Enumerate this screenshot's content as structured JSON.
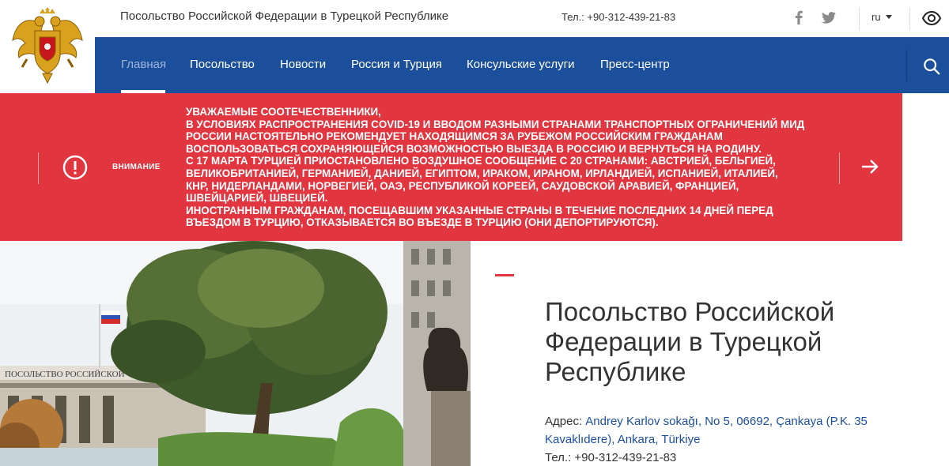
{
  "header": {
    "title": "Посольство Российской Федерации в Турецкой Республике",
    "phone": "Тел.: +90-312-439-21-83",
    "lang": "ru",
    "icons": [
      "coat-of-arms",
      "facebook-icon",
      "twitter-icon",
      "chevron-down-icon",
      "eye-icon"
    ]
  },
  "nav": {
    "items": [
      {
        "label": "Главная"
      },
      {
        "label": "Посольство"
      },
      {
        "label": "Новости"
      },
      {
        "label": "Россия и Турция"
      },
      {
        "label": "Консульские услуги"
      },
      {
        "label": "Пресс-центр"
      }
    ],
    "active": "Главная"
  },
  "alert": {
    "label": "ВНИМАНИЕ",
    "lines": [
      "Уважаемые соотечественники,",
      "в условиях распространения COVID-19 и вводом разными странами транспортных ограничений МИД",
      "России настоятельно рекомендует находящимся за рубежом российским гражданам",
      "воспользоваться сохраняющейся возможностью выезда в Россию и вернуться на родину.",
      "С 17 марта Турцией приостановлено воздушное сообщение с 20 странами: Австрией, Бельгией,",
      "Великобританией, Германией, Данией, Египтом, Ираком, Ираном, Ирландией, Испанией, Италией,",
      "КНР, Нидерландами, Норвегией, ОАЭ, Республикой Кореей, Саудовской Аравией, Францией,",
      "Швейцарией, Швецией.",
      "Иностранным гражданам, посещавшим указанные страны в течение последних 14 дней перед",
      "въездом в Турцию, отказывается во въезде в Турцию (они депортируются)."
    ],
    "colors": {
      "background": "#e1353f"
    }
  },
  "photo": {
    "sign_text": "ПОСОЛЬСТВО РОССИЙСКОЙ ФЕДЕРАЦИИ"
  },
  "info": {
    "heading": "Посольство Российской Федерации в Турецкой Республике",
    "address_label": "Адрес:",
    "address_value": "Andrey Karlov sokağı, No 5, 06692, Çankaya (P.K. 35 Kavaklıdere), Ankara, Türkiye",
    "phone": "Тел.: +90-312-439-21-83"
  },
  "colors": {
    "nav": "#1b4f9c",
    "alert": "#e1353f",
    "link": "#1b4f9c"
  }
}
